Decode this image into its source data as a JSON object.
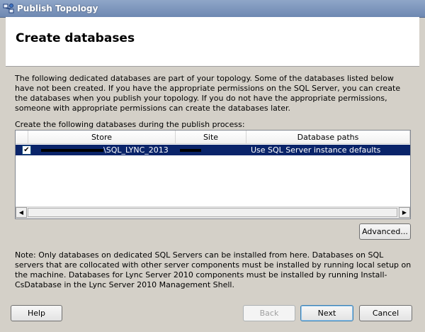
{
  "window": {
    "title": "Publish Topology"
  },
  "header": {
    "title": "Create databases"
  },
  "description": "The following dedicated databases are part of your topology. Some of the databases listed below have not been created. If you have the appropriate permissions on the SQL Server, you can create the databases when you publish your topology. If you do not have the appropriate permissions, someone with appropriate permissions can create the databases later.",
  "list": {
    "label": "Create the following databases during the publish process:",
    "columns": [
      "Store",
      "Site",
      "Database paths"
    ],
    "rows": [
      {
        "checked": true,
        "store": "\\SQL_LYNC_2013",
        "site": "",
        "paths": "Use SQL Server instance defaults"
      }
    ]
  },
  "buttons": {
    "advanced": "Advanced...",
    "help": "Help",
    "back": "Back",
    "next": "Next",
    "cancel": "Cancel"
  },
  "note": "Note: Only databases on dedicated SQL Servers can be installed from here. Databases on SQL servers that are collocated with other server components must be installed by running local setup on the machine. Databases for Lync Server 2010 components must be installed by running Install-CsDatabase in the Lync Server 2010 Management Shell."
}
